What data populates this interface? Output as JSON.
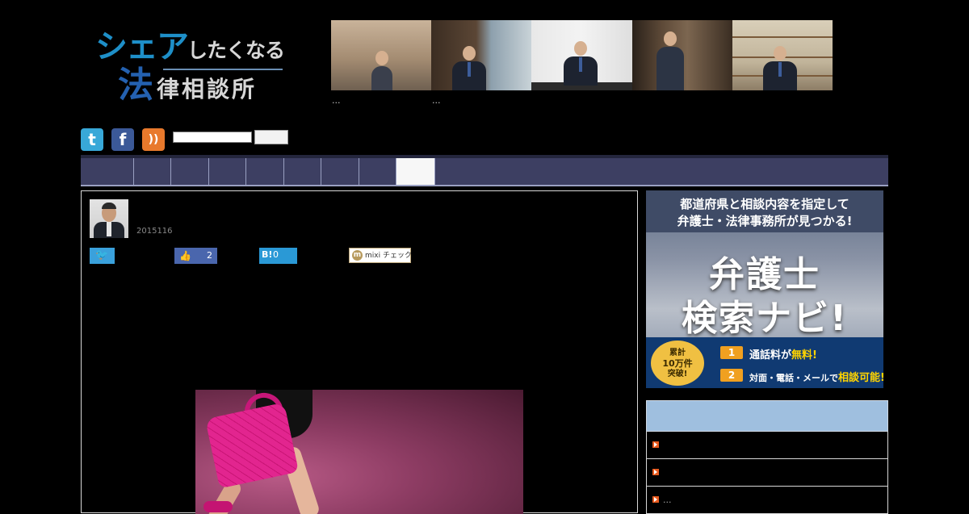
{
  "logo": {
    "line1_big": "シェア",
    "line1_small": "したくなる",
    "line2_big": "法",
    "line2_small": "律相談所",
    "colors": {
      "blue": "#1e8fc8",
      "navy": "#2461b0",
      "gray": "#d7d7d7"
    }
  },
  "header": {
    "captions": [
      "...",
      "..."
    ]
  },
  "social": {
    "twitter_glyph": "t",
    "facebook_glyph": "f",
    "rss_glyph": "))"
  },
  "search": {
    "placeholder": "",
    "button_label": ""
  },
  "nav": {
    "tab_count": 9,
    "active_index": 8,
    "colors": {
      "bar": "#3d3f62",
      "active": "#f7f7f7"
    }
  },
  "article": {
    "date": "2015116",
    "share": {
      "twitter_glyph": "🐦",
      "like_glyph": "👍",
      "like_count": "2",
      "hatena_glyph": "B!",
      "hatena_count": "0",
      "mixi_glyph": "m",
      "mixi_label": "mixi チェック"
    }
  },
  "banner": {
    "headline1": "都道府県と相談内容を指定して",
    "headline2": "弁護士・法律事務所が見つかる!",
    "title1": "弁護士",
    "title2": "検索ナビ!",
    "seal1": "累計",
    "seal2": "10万件",
    "seal3": "突破!",
    "num1": "1",
    "item1_pre": "通話料が",
    "item1_em": "無料!",
    "num2": "2",
    "item2_pre": "対面・電話・メールで",
    "item2_em": "相談可能!"
  },
  "sidebar": {
    "items": [
      "",
      "",
      "..."
    ]
  }
}
